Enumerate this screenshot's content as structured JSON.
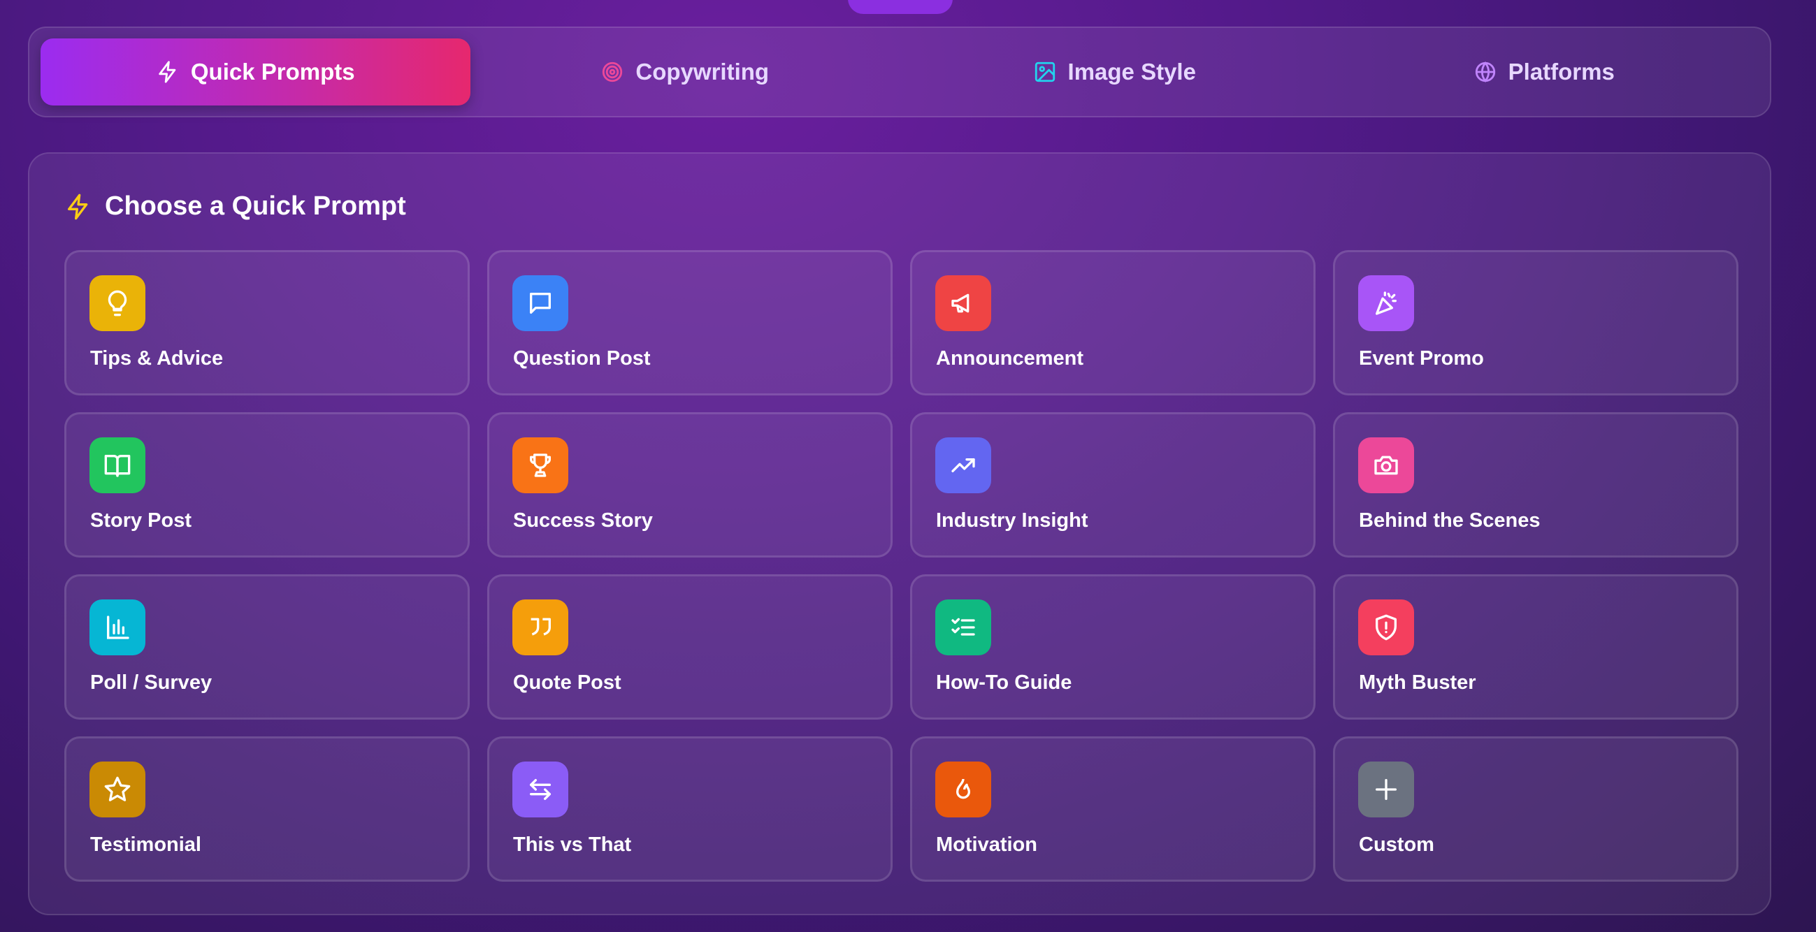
{
  "tabs": [
    {
      "label": "Quick Prompts",
      "icon": "lightning-icon",
      "active": true
    },
    {
      "label": "Copywriting",
      "icon": "target-icon",
      "active": false
    },
    {
      "label": "Image Style",
      "icon": "image-icon",
      "active": false
    },
    {
      "label": "Platforms",
      "icon": "globe-icon",
      "active": false
    }
  ],
  "panel": {
    "title": "Choose a Quick Prompt",
    "icon": "lightning-icon"
  },
  "prompts": [
    {
      "label": "Tips & Advice",
      "icon": "lightbulb-icon",
      "color": "#eab308"
    },
    {
      "label": "Question Post",
      "icon": "chat-bubble-icon",
      "color": "#3b82f6"
    },
    {
      "label": "Announcement",
      "icon": "megaphone-icon",
      "color": "#ef4444"
    },
    {
      "label": "Event Promo",
      "icon": "party-popper-icon",
      "color": "#a855f7"
    },
    {
      "label": "Story Post",
      "icon": "open-book-icon",
      "color": "#22c55e"
    },
    {
      "label": "Success Story",
      "icon": "trophy-icon",
      "color": "#f97316"
    },
    {
      "label": "Industry Insight",
      "icon": "trending-up-icon",
      "color": "#6366f1"
    },
    {
      "label": "Behind the Scenes",
      "icon": "camera-icon",
      "color": "#ec4899"
    },
    {
      "label": "Poll / Survey",
      "icon": "bar-chart-icon",
      "color": "#06b6d4"
    },
    {
      "label": "Quote Post",
      "icon": "quote-icon",
      "color": "#f59e0b"
    },
    {
      "label": "How-To Guide",
      "icon": "checklist-icon",
      "color": "#10b981"
    },
    {
      "label": "Myth Buster",
      "icon": "shield-alert-icon",
      "color": "#f43f5e"
    },
    {
      "label": "Testimonial",
      "icon": "star-icon",
      "color": "#ca8a04"
    },
    {
      "label": "This vs That",
      "icon": "swap-arrows-icon",
      "color": "#8b5cf6"
    },
    {
      "label": "Motivation",
      "icon": "flame-icon",
      "color": "#ea580c"
    },
    {
      "label": "Custom",
      "icon": "plus-icon",
      "color": "#6b7280"
    }
  ]
}
